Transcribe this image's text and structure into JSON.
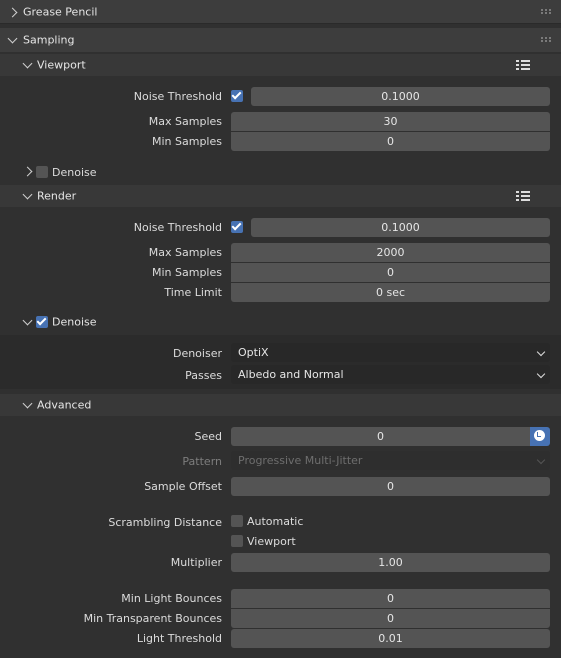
{
  "panels": {
    "grease_pencil": {
      "title": "Grease Pencil"
    },
    "sampling": {
      "title": "Sampling"
    }
  },
  "viewport": {
    "title": "Viewport",
    "noise_threshold": {
      "label": "Noise Threshold",
      "enabled": true,
      "value": "0.1000"
    },
    "max_samples": {
      "label": "Max Samples",
      "value": "30"
    },
    "min_samples": {
      "label": "Min Samples",
      "value": "0"
    },
    "denoise": {
      "label": "Denoise",
      "enabled": false
    }
  },
  "render": {
    "title": "Render",
    "noise_threshold": {
      "label": "Noise Threshold",
      "enabled": true,
      "value": "0.1000"
    },
    "max_samples": {
      "label": "Max Samples",
      "value": "2000"
    },
    "min_samples": {
      "label": "Min Samples",
      "value": "0"
    },
    "time_limit": {
      "label": "Time Limit",
      "value": "0 sec"
    }
  },
  "denoise": {
    "title": "Denoise",
    "enabled": true,
    "denoiser": {
      "label": "Denoiser",
      "value": "OptiX"
    },
    "passes": {
      "label": "Passes",
      "value": "Albedo and Normal"
    }
  },
  "advanced": {
    "title": "Advanced",
    "seed": {
      "label": "Seed",
      "value": "0"
    },
    "pattern": {
      "label": "Pattern",
      "value": "Progressive Multi-Jitter"
    },
    "sample_offset": {
      "label": "Sample Offset",
      "value": "0"
    },
    "scrambling_distance": {
      "label": "Scrambling Distance",
      "automatic_label": "Automatic",
      "automatic": false,
      "viewport_label": "Viewport",
      "viewport": false
    },
    "multiplier": {
      "label": "Multiplier",
      "value": "1.00"
    },
    "min_light_bounces": {
      "label": "Min Light Bounces",
      "value": "0"
    },
    "min_transparent_bounces": {
      "label": "Min Transparent Bounces",
      "value": "0"
    },
    "light_threshold": {
      "label": "Light Threshold",
      "value": "0.01"
    }
  },
  "colors": {
    "accent": "#4772b3",
    "background": "#303030",
    "field": "#545454"
  }
}
